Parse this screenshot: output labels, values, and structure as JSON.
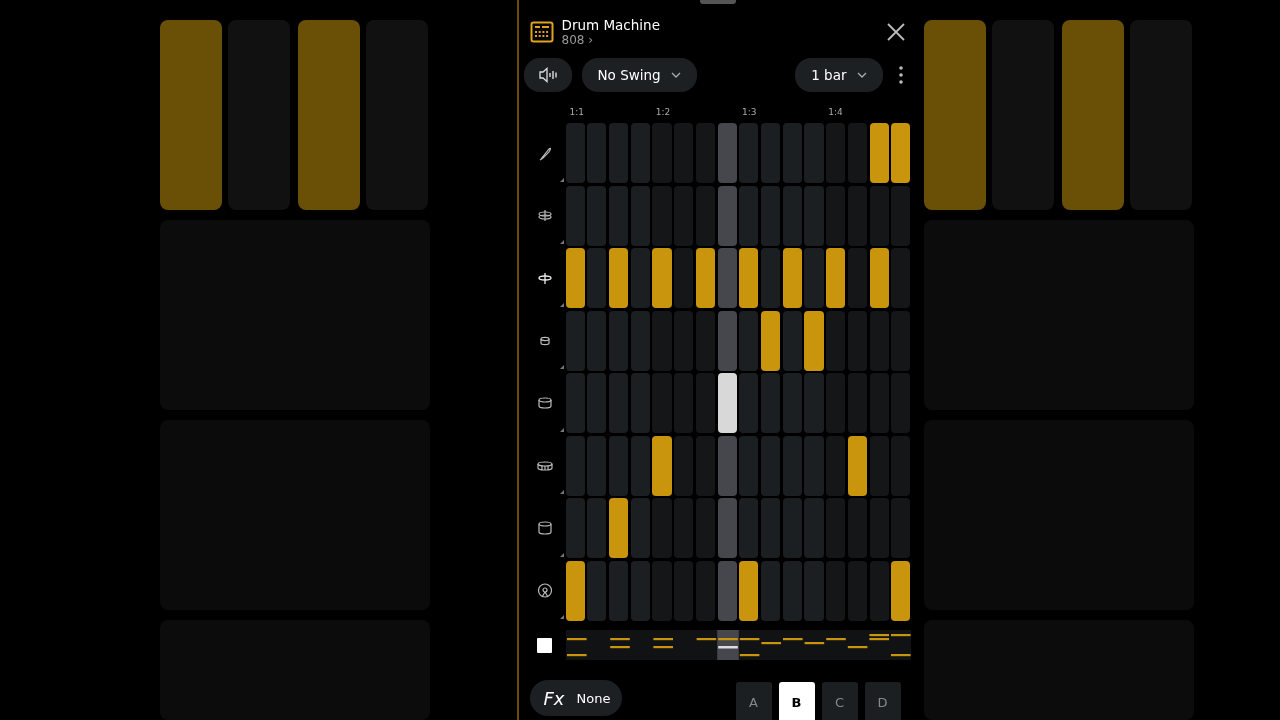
{
  "header": {
    "title": "Drum Machine",
    "kit": "808",
    "kit_arrow": "›"
  },
  "toolbar": {
    "swing": "No Swing",
    "length": "1 bar"
  },
  "ruler": [
    "1:1",
    "1:2",
    "1:3",
    "1:4"
  ],
  "timeline": {
    "playhead": [
      false,
      false,
      false,
      false,
      false,
      false,
      false,
      true,
      false,
      false,
      false,
      false,
      false,
      false,
      false,
      false
    ]
  },
  "tracks": [
    {
      "selected": false,
      "steps": [
        false,
        false,
        false,
        false,
        false,
        false,
        false,
        false,
        false,
        false,
        false,
        false,
        false,
        false,
        true,
        true
      ]
    },
    {
      "selected": false,
      "steps": [
        false,
        false,
        false,
        false,
        false,
        false,
        false,
        false,
        false,
        false,
        false,
        false,
        false,
        false,
        false,
        false
      ]
    },
    {
      "selected": false,
      "steps": [
        true,
        false,
        true,
        false,
        true,
        false,
        true,
        false,
        true,
        false,
        true,
        false,
        true,
        false,
        true,
        false
      ]
    },
    {
      "selected": false,
      "steps": [
        false,
        false,
        false,
        false,
        false,
        false,
        false,
        false,
        false,
        true,
        false,
        true,
        false,
        false,
        false,
        false
      ]
    },
    {
      "selected": true,
      "steps": [
        false,
        false,
        false,
        false,
        false,
        false,
        false,
        false,
        false,
        false,
        false,
        false,
        false,
        false,
        false,
        false
      ]
    },
    {
      "selected": false,
      "steps": [
        false,
        false,
        false,
        false,
        true,
        false,
        false,
        false,
        false,
        false,
        false,
        false,
        false,
        true,
        false,
        false
      ]
    },
    {
      "selected": false,
      "steps": [
        false,
        false,
        true,
        false,
        false,
        false,
        false,
        false,
        false,
        false,
        false,
        false,
        false,
        false,
        false,
        false
      ]
    },
    {
      "selected": false,
      "steps": [
        true,
        false,
        false,
        false,
        false,
        false,
        false,
        false,
        true,
        false,
        false,
        false,
        false,
        false,
        false,
        true
      ]
    }
  ],
  "fx": {
    "label": "Fx",
    "value": "None"
  },
  "patterns": [
    {
      "label": "A",
      "selected": false
    },
    {
      "label": "B",
      "selected": true
    },
    {
      "label": "C",
      "selected": false
    },
    {
      "label": "D",
      "selected": false
    }
  ]
}
